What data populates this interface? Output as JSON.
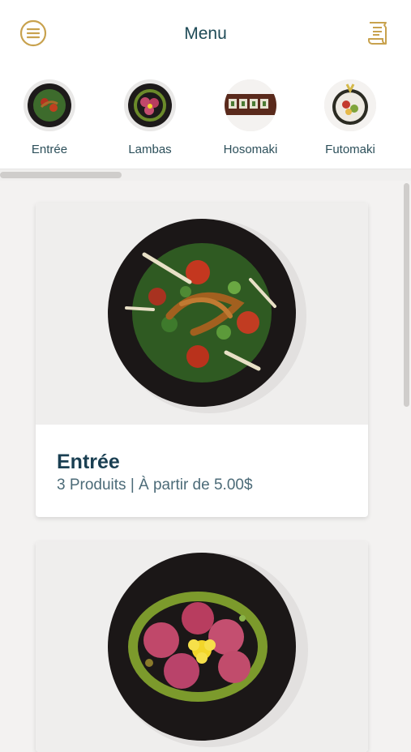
{
  "header": {
    "title": "Menu",
    "menu_icon": "menu-lines-icon",
    "receipt_icon": "receipt-icon",
    "accent": "#c8a24e"
  },
  "categories": [
    {
      "label": "Entrée",
      "image": "salad-bowl"
    },
    {
      "label": "Lambas",
      "image": "tuna-roll-bowl"
    },
    {
      "label": "Hosomaki",
      "image": "hosomaki-plate"
    },
    {
      "label": "Futomaki",
      "image": "futomaki-roll"
    }
  ],
  "cards": [
    {
      "name": "Entrée",
      "info": "3 Produits | À partir de 5.00$",
      "image": "salad-bowl"
    },
    {
      "name": "",
      "info": "",
      "image": "tuna-roll-bowl"
    }
  ]
}
